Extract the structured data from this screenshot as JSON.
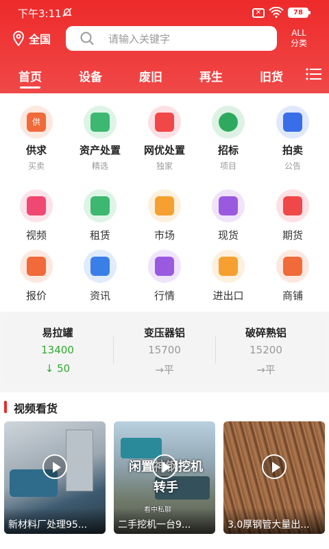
{
  "status": {
    "time": "下午3:11",
    "battery": "78"
  },
  "header": {
    "location": "全国",
    "search_placeholder": "请输入关键字",
    "all_line1": "ALL",
    "all_line2": "分类"
  },
  "tabs": [
    "首页",
    "设备",
    "废旧",
    "再生",
    "旧货"
  ],
  "grid_row1": [
    {
      "label": "供求",
      "sub": "买卖",
      "icon": "supply-icon",
      "color": "#f06a3a"
    },
    {
      "label": "资产处置",
      "sub": "精选",
      "icon": "asset-building-icon",
      "color": "#3cb870"
    },
    {
      "label": "网优处置",
      "sub": "独家",
      "icon": "document-icon",
      "color": "#f04848"
    },
    {
      "label": "招标",
      "sub": "项目",
      "icon": "target-icon",
      "color": "#2eaa5e"
    },
    {
      "label": "拍卖",
      "sub": "公告",
      "icon": "gavel-icon",
      "color": "#3a6ee8"
    }
  ],
  "grid_row2": [
    {
      "label": "视频",
      "icon": "video-icon",
      "color": "#f04870"
    },
    {
      "label": "租赁",
      "icon": "tools-icon",
      "color": "#3cb870"
    },
    {
      "label": "市场",
      "icon": "building-icon",
      "color": "#f5a030"
    },
    {
      "label": "现货",
      "icon": "spot-goods-icon",
      "color": "#9a5ae0"
    },
    {
      "label": "期货",
      "icon": "warehouse-icon",
      "color": "#f04848"
    }
  ],
  "grid_row3": [
    {
      "label": "报价",
      "icon": "list-icon",
      "color": "#f06a3a"
    },
    {
      "label": "资讯",
      "icon": "news-icon",
      "color": "#3a7ee8"
    },
    {
      "label": "行情",
      "icon": "trend-icon",
      "color": "#9a5ae0"
    },
    {
      "label": "进出口",
      "icon": "exchange-icon",
      "color": "#f5a030"
    },
    {
      "label": "商铺",
      "icon": "shop-icon",
      "color": "#f06a3a"
    }
  ],
  "prices": [
    {
      "name": "易拉罐",
      "value": "13400",
      "change": "↓ 50",
      "trend": "up"
    },
    {
      "name": "变压器铝",
      "value": "15700",
      "change": "→平",
      "trend": "flat"
    },
    {
      "name": "破碎熟铝",
      "value": "15200",
      "change": "→平",
      "trend": "flat"
    }
  ],
  "video": {
    "title": "视频看货",
    "items": [
      {
        "caption": "新材料厂处理95..."
      },
      {
        "caption": "二手挖机一台9...",
        "overlay": "闲置神钢挖机转手",
        "note": "看中私聊"
      },
      {
        "caption": "3.0厚钢管大量出..."
      }
    ]
  }
}
